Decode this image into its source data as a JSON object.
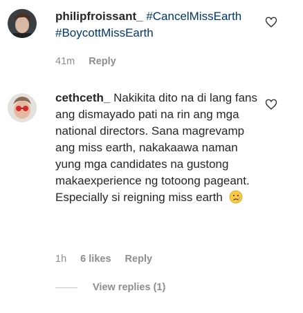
{
  "comments": [
    {
      "username": "philipfroissant_",
      "tags": [
        "#CancelMissEarth",
        "#BoycottMissEarth"
      ],
      "time": "41m",
      "reply_label": "Reply",
      "avatar_icon": "profile-photo",
      "like_icon": "heart-outline-icon"
    },
    {
      "username": "cethceth_",
      "text": "Nakikita dito na di lang fans ang dismayado pati na rin ang mga national directors. Sana magrevamp ang miss earth, nakakaawa naman yung mga candidates na gustong makaexperience ng totoong pageant. Especially si reigning miss earth",
      "emoji": "sad-tear-face-emoji",
      "time": "1h",
      "likes": "6 likes",
      "reply_label": "Reply",
      "view_replies": "View replies (1)",
      "avatar_icon": "profile-photo",
      "like_icon": "heart-outline-icon"
    }
  ],
  "colors": {
    "text": "#262626",
    "hashtag": "#00376b",
    "secondary": "#8e8e8e"
  }
}
